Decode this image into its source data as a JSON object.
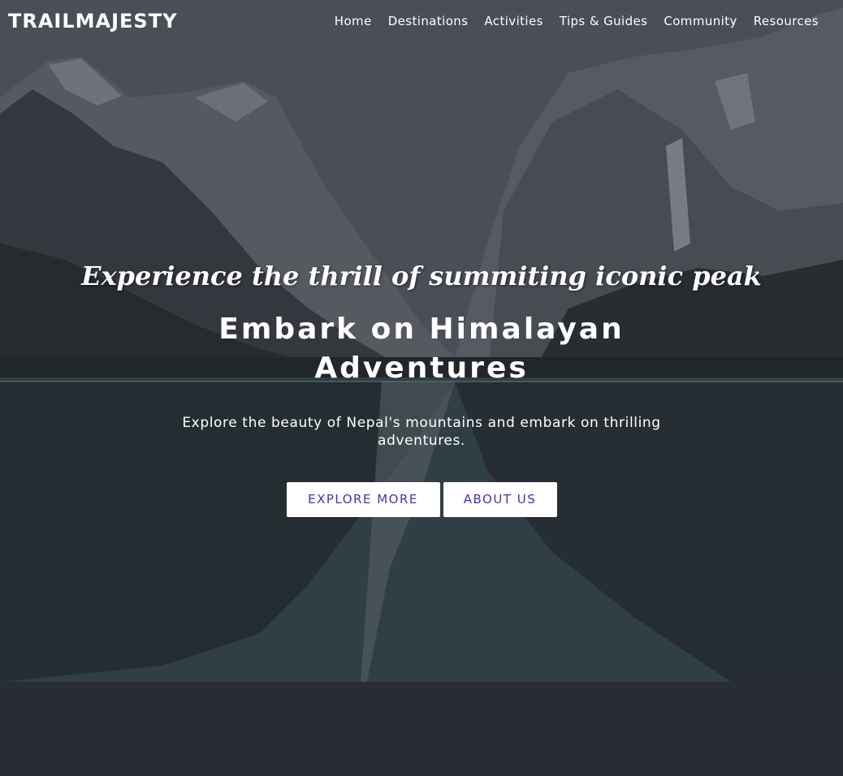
{
  "brand": {
    "name": "TRAILMAJESTY"
  },
  "nav": {
    "items": [
      {
        "label": "Home"
      },
      {
        "label": "Destinations"
      },
      {
        "label": "Activities"
      },
      {
        "label": "Tips & Guides"
      },
      {
        "label": "Community"
      },
      {
        "label": "Resources"
      }
    ]
  },
  "hero": {
    "tagline": "Experience the thrill of summiting iconic peak",
    "headline": "Embark on Himalayan Adventures",
    "subtext": "Explore the beauty of Nepal's mountains and embark on thrilling adventures.",
    "buttons": {
      "explore_label": "EXPLORE MORE",
      "about_label": "ABOUT US"
    }
  },
  "colors": {
    "button_text": "#4a2fb8",
    "button_bg": "#ffffff",
    "text": "#ffffff"
  },
  "background_image": "snowy mountain lake reflection"
}
